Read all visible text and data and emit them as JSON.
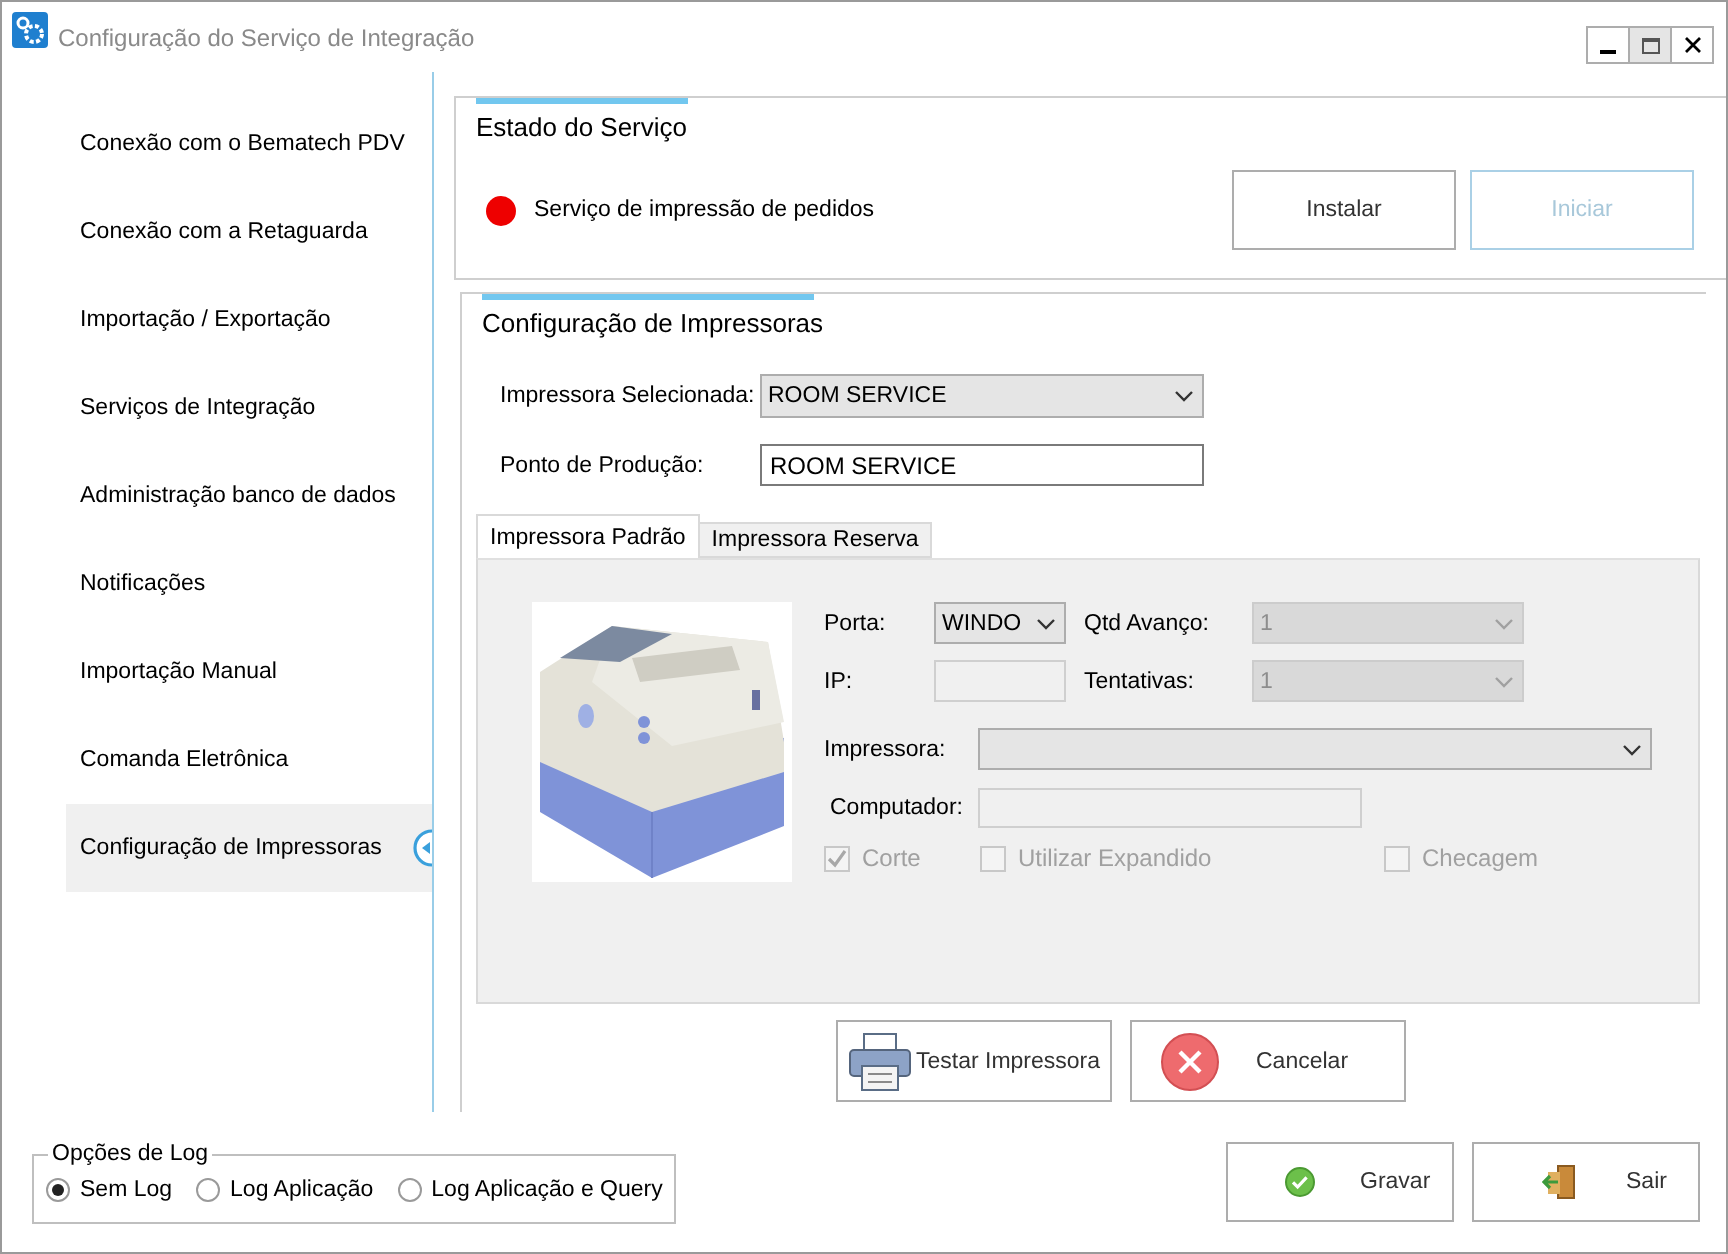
{
  "window": {
    "title": "Configuração do Serviço de Integração"
  },
  "sidebar": {
    "items": [
      {
        "label": "Conexão com o Bematech PDV",
        "selected": false
      },
      {
        "label": "Conexão com a Retaguarda",
        "selected": false
      },
      {
        "label": "Importação / Exportação",
        "selected": false
      },
      {
        "label": "Serviços de Integração",
        "selected": false
      },
      {
        "label": "Administração banco de dados",
        "selected": false
      },
      {
        "label": "Notificações",
        "selected": false
      },
      {
        "label": "Importação Manual",
        "selected": false
      },
      {
        "label": "Comanda Eletrônica",
        "selected": false
      },
      {
        "label": "Configuração de Impressoras",
        "selected": true
      }
    ]
  },
  "service_status": {
    "title": "Estado do Serviço",
    "status_label": "Serviço de impressão de pedidos",
    "running": false,
    "buttons": [
      {
        "label": "Instalar",
        "disabled": false
      },
      {
        "label": "Iniciar",
        "disabled": true
      }
    ]
  },
  "printer_config": {
    "title": "Configuração de Impressoras",
    "fields": [
      {
        "label": "Impressora Selecionada:",
        "kind": "select",
        "value": "ROOM SERVICE"
      },
      {
        "label": "Ponto de Produção:",
        "kind": "text",
        "value": "ROOM SERVICE"
      }
    ],
    "tabs": [
      {
        "label": "Impressora Padrão",
        "selected": true
      },
      {
        "label": "Impressora Reserva",
        "selected": false
      }
    ],
    "panel": {
      "port": {
        "label": "Porta:",
        "value": "WINDO",
        "disabled": false
      },
      "feed": {
        "label": "Qtd Avanço:",
        "value": "1",
        "disabled": true
      },
      "ip": {
        "label": "IP:",
        "disabled": true
      },
      "retries": {
        "label": "Tentativas:",
        "value": "1",
        "disabled": true
      },
      "printer": {
        "label": "Impressora:",
        "disabled": false
      },
      "computer": {
        "label": "Computador:",
        "disabled": true
      },
      "checkboxes": [
        {
          "label": "Corte",
          "checked": true,
          "disabled": true
        },
        {
          "label": "Utilizar Expandido",
          "checked": false,
          "disabled": true
        },
        {
          "label": "Checagem",
          "checked": false,
          "disabled": true
        }
      ]
    },
    "actions": [
      {
        "label": "Testar Impressora"
      },
      {
        "label": "Cancelar"
      }
    ]
  },
  "log_options": {
    "title": "Opções de Log",
    "options": [
      {
        "label": "Sem Log",
        "selected": true
      },
      {
        "label": "Log Aplicação",
        "selected": false
      },
      {
        "label": "Log Aplicação e Query",
        "selected": false
      }
    ]
  },
  "footer_buttons": [
    {
      "label": "Gravar"
    },
    {
      "label": "Sair"
    }
  ]
}
